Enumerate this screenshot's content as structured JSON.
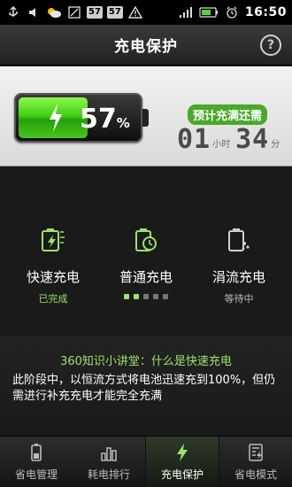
{
  "statusbar": {
    "time": "16:50",
    "badges": [
      "57",
      "57"
    ],
    "icons": [
      "usb-icon",
      "volume-icon",
      "weather-icon",
      "battery-full-icon",
      "warning-icon",
      "signal-icon",
      "alarm-icon"
    ]
  },
  "header": {
    "title": "充电保护",
    "help_label": "?"
  },
  "battery": {
    "percent_value": "57",
    "percent_sign": "%",
    "level": 0.57,
    "eta_label": "预计充满还需",
    "hours": "01",
    "hours_unit": "小时",
    "minutes": "34",
    "minutes_unit": "分"
  },
  "modes": [
    {
      "name": "快速充电",
      "status": "已完成",
      "icon": "fast-charge-icon"
    },
    {
      "name": "普通充电",
      "status": "",
      "icon": "normal-charge-icon",
      "progress_dots": 5,
      "progress_on": 2
    },
    {
      "name": "涓流充电",
      "status": "等待中",
      "icon": "trickle-charge-icon"
    }
  ],
  "tip": {
    "title": "360知识小讲堂：什么是快速充电",
    "body": "此阶段中，以恒流方式将电池迅速充到100%，但仍需进行补充充电才能完全充满"
  },
  "tabs": [
    {
      "label": "省电管理",
      "icon": "battery-manage-icon"
    },
    {
      "label": "耗电排行",
      "icon": "bar-chart-icon"
    },
    {
      "label": "充电保护",
      "icon": "charge-bolt-icon",
      "active": true
    },
    {
      "label": "省电模式",
      "icon": "list-bolt-icon"
    }
  ],
  "colors": {
    "accent_green": "#9be36b",
    "badge_green": "#4aa82a"
  }
}
